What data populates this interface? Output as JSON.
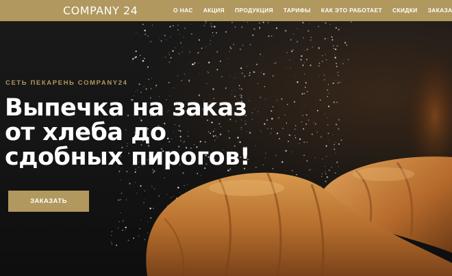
{
  "header": {
    "logo": "COMPANY 24",
    "nav": [
      {
        "label": "О НАС"
      },
      {
        "label": "АКЦИЯ"
      },
      {
        "label": "ПРОДУКЦИЯ"
      },
      {
        "label": "ТАРИФЫ"
      },
      {
        "label": "КАК ЭТО РАБОТАЕТ"
      },
      {
        "label": "СКИДКИ"
      },
      {
        "label": "ЗАКАЗАТЬ"
      }
    ]
  },
  "hero": {
    "subtitle": "СЕТЬ ПЕКАРЕНЬ COMPANY24",
    "headline": [
      "Выпечка на заказ",
      "от хлеба до",
      "сдобных пирогов!"
    ],
    "button_label": "ЗАКАЗАТЬ"
  },
  "colors": {
    "accent": "#b0985e",
    "text_light": "#ffffff",
    "background": "#141414"
  }
}
